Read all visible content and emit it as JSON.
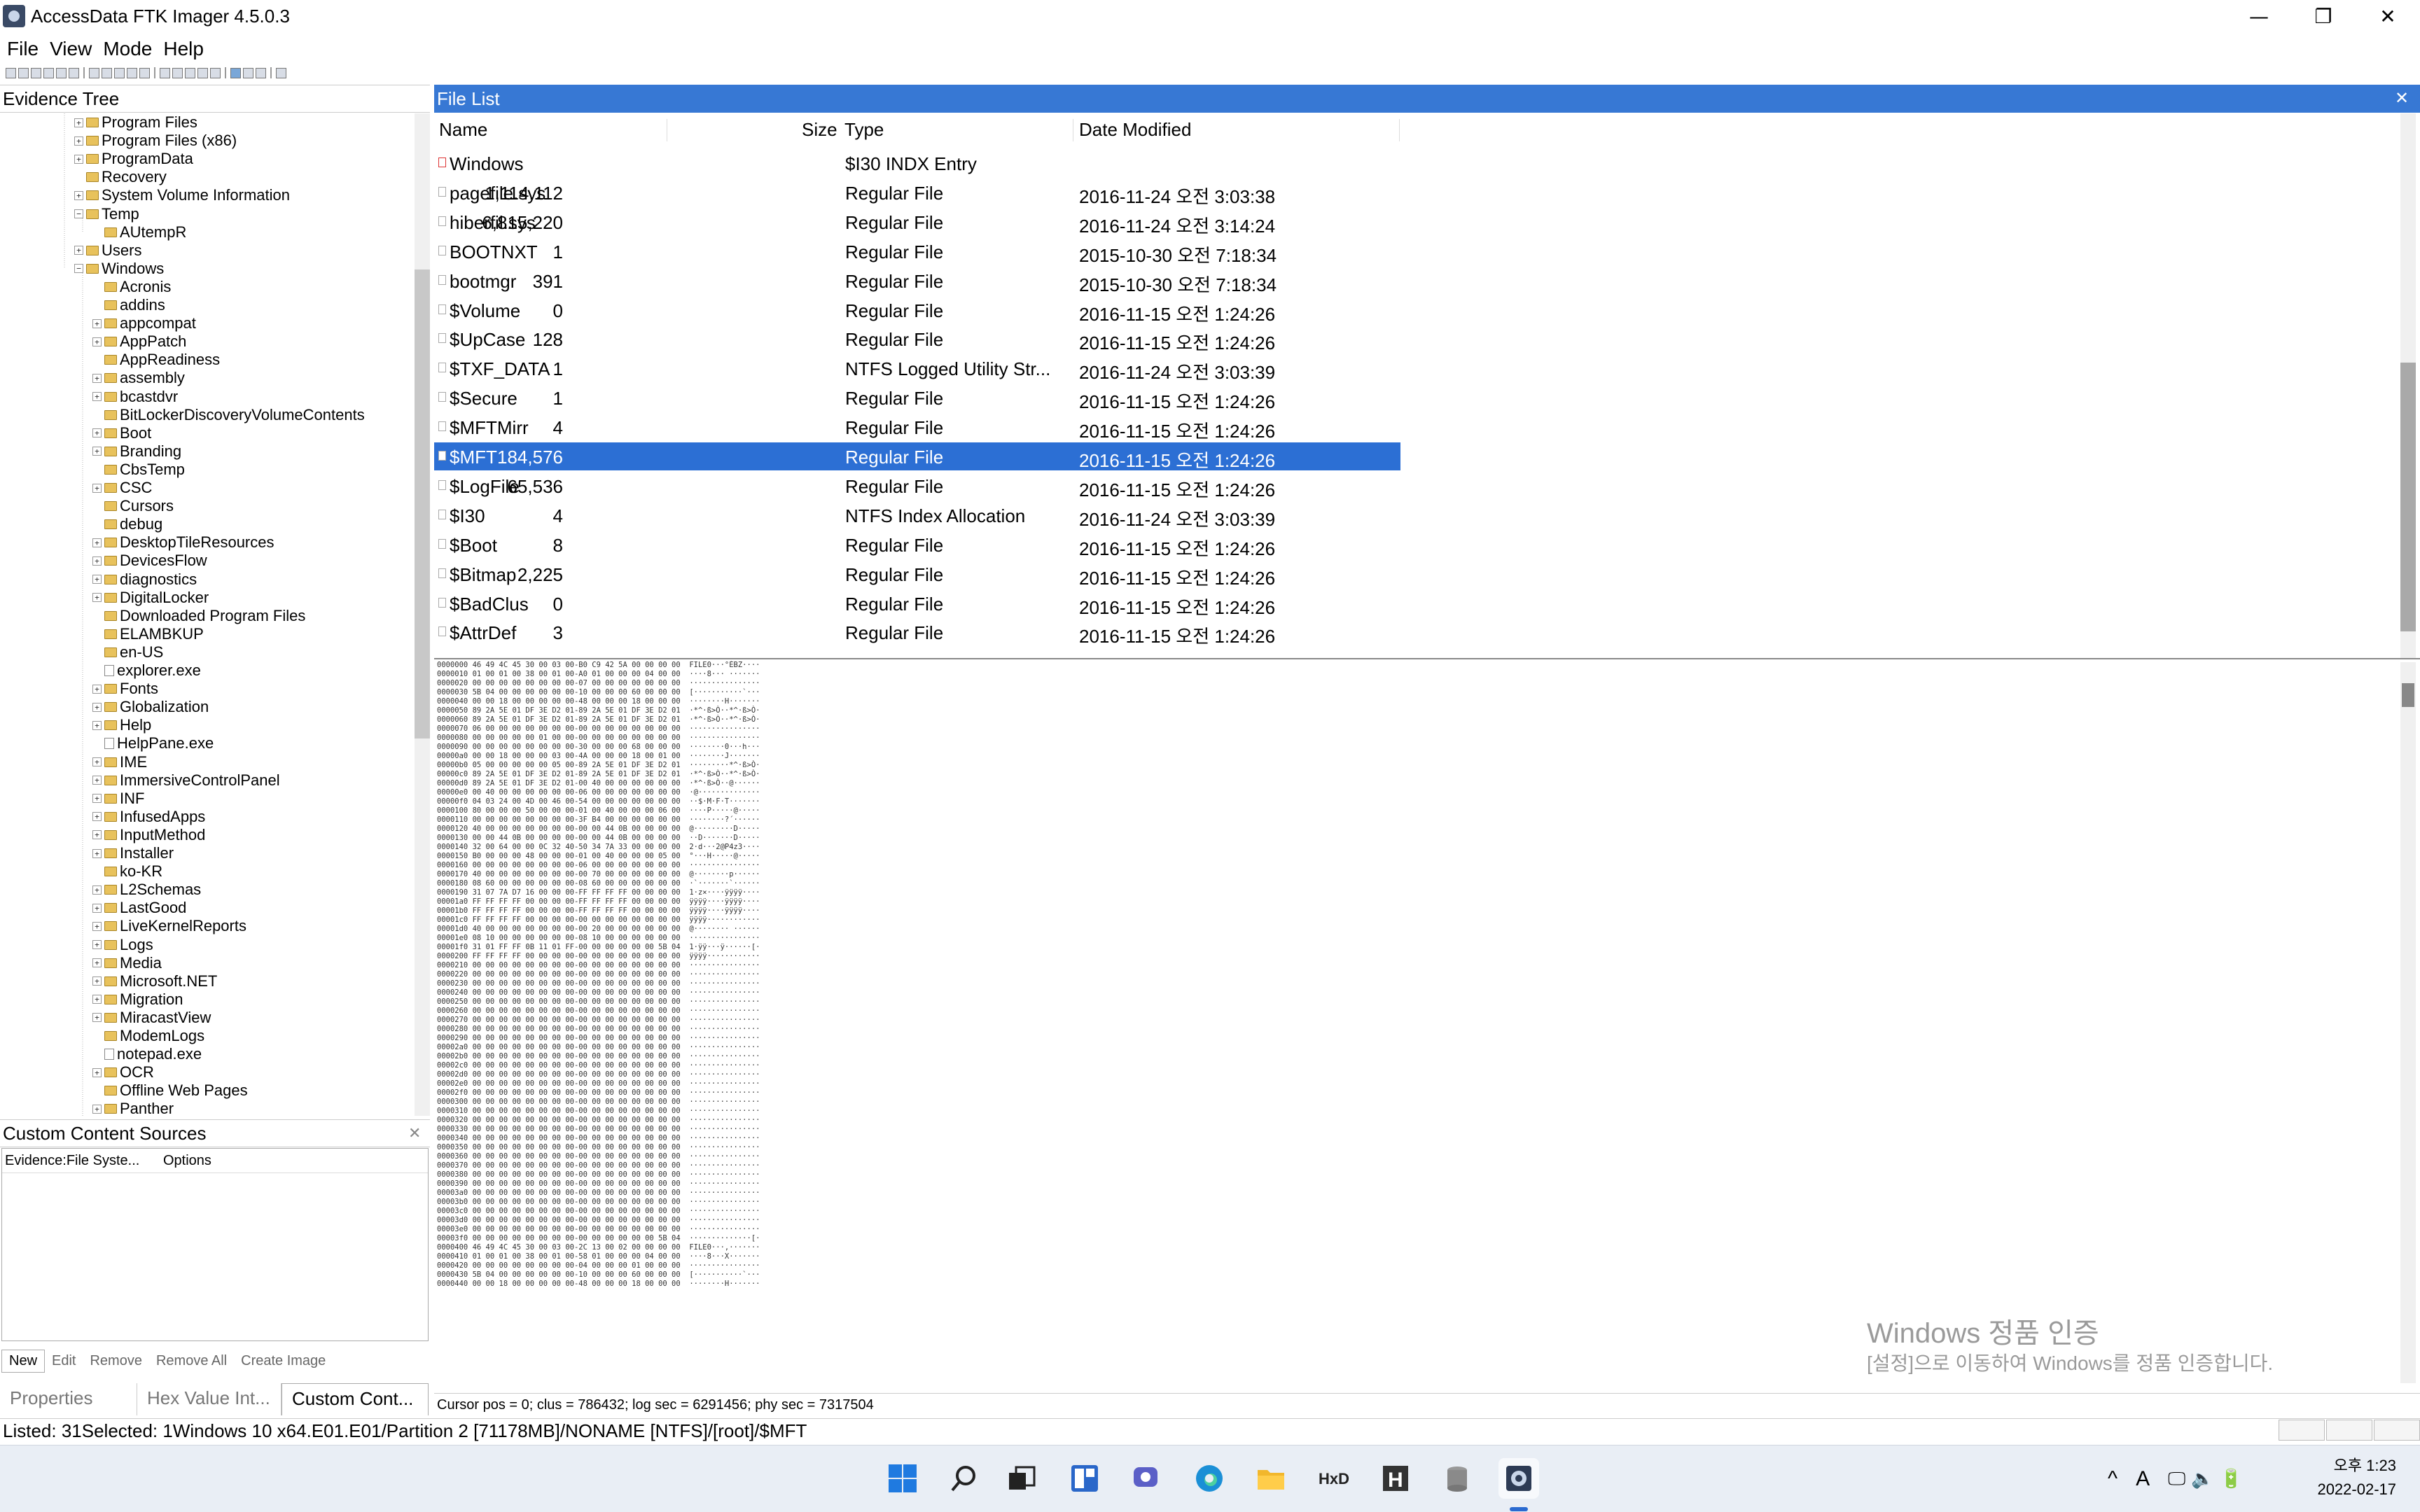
{
  "window": {
    "title": "AccessData FTK Imager 4.5.0.3",
    "controls": {
      "minimize": "—",
      "maximize": "❐",
      "close": "✕"
    }
  },
  "menu": [
    "File",
    "View",
    "Mode",
    "Help"
  ],
  "evidence_tree": {
    "title": "Evidence Tree",
    "items": [
      {
        "label": "Program Files",
        "level": 1,
        "expander": "+"
      },
      {
        "label": "Program Files (x86)",
        "level": 1,
        "expander": "+"
      },
      {
        "label": "ProgramData",
        "level": 1,
        "expander": "+"
      },
      {
        "label": "Recovery",
        "level": 1,
        "expander": ""
      },
      {
        "label": "System Volume Information",
        "level": 1,
        "expander": "+"
      },
      {
        "label": "Temp",
        "level": 1,
        "expander": "−"
      },
      {
        "label": "AUtempR",
        "level": 2,
        "expander": ""
      },
      {
        "label": "Users",
        "level": 1,
        "expander": "+"
      },
      {
        "label": "Windows",
        "level": 1,
        "expander": "−"
      },
      {
        "label": "Acronis",
        "level": 2,
        "expander": ""
      },
      {
        "label": "addins",
        "level": 2,
        "expander": ""
      },
      {
        "label": "appcompat",
        "level": 2,
        "expander": "+"
      },
      {
        "label": "AppPatch",
        "level": 2,
        "expander": "+"
      },
      {
        "label": "AppReadiness",
        "level": 2,
        "expander": ""
      },
      {
        "label": "assembly",
        "level": 2,
        "expander": "+"
      },
      {
        "label": "bcastdvr",
        "level": 2,
        "expander": "+"
      },
      {
        "label": "BitLockerDiscoveryVolumeContents",
        "level": 2,
        "expander": ""
      },
      {
        "label": "Boot",
        "level": 2,
        "expander": "+"
      },
      {
        "label": "Branding",
        "level": 2,
        "expander": "+"
      },
      {
        "label": "CbsTemp",
        "level": 2,
        "expander": ""
      },
      {
        "label": "CSC",
        "level": 2,
        "expander": "+"
      },
      {
        "label": "Cursors",
        "level": 2,
        "expander": ""
      },
      {
        "label": "debug",
        "level": 2,
        "expander": ""
      },
      {
        "label": "DesktopTileResources",
        "level": 2,
        "expander": "+"
      },
      {
        "label": "DevicesFlow",
        "level": 2,
        "expander": "+"
      },
      {
        "label": "diagnostics",
        "level": 2,
        "expander": "+"
      },
      {
        "label": "DigitalLocker",
        "level": 2,
        "expander": "+"
      },
      {
        "label": "Downloaded Program Files",
        "level": 2,
        "expander": ""
      },
      {
        "label": "ELAMBKUP",
        "level": 2,
        "expander": ""
      },
      {
        "label": "en-US",
        "level": 2,
        "expander": ""
      },
      {
        "label": "explorer.exe",
        "level": 2,
        "expander": "",
        "file": true
      },
      {
        "label": "Fonts",
        "level": 2,
        "expander": "+"
      },
      {
        "label": "Globalization",
        "level": 2,
        "expander": "+"
      },
      {
        "label": "Help",
        "level": 2,
        "expander": "+"
      },
      {
        "label": "HelpPane.exe",
        "level": 2,
        "expander": "",
        "file": true
      },
      {
        "label": "IME",
        "level": 2,
        "expander": "+"
      },
      {
        "label": "ImmersiveControlPanel",
        "level": 2,
        "expander": "+"
      },
      {
        "label": "INF",
        "level": 2,
        "expander": "+"
      },
      {
        "label": "InfusedApps",
        "level": 2,
        "expander": "+"
      },
      {
        "label": "InputMethod",
        "level": 2,
        "expander": "+"
      },
      {
        "label": "Installer",
        "level": 2,
        "expander": "+"
      },
      {
        "label": "ko-KR",
        "level": 2,
        "expander": ""
      },
      {
        "label": "L2Schemas",
        "level": 2,
        "expander": "+"
      },
      {
        "label": "LastGood",
        "level": 2,
        "expander": "+"
      },
      {
        "label": "LiveKernelReports",
        "level": 2,
        "expander": "+"
      },
      {
        "label": "Logs",
        "level": 2,
        "expander": "+"
      },
      {
        "label": "Media",
        "level": 2,
        "expander": "+"
      },
      {
        "label": "Microsoft.NET",
        "level": 2,
        "expander": "+"
      },
      {
        "label": "Migration",
        "level": 2,
        "expander": "+"
      },
      {
        "label": "MiracastView",
        "level": 2,
        "expander": "+"
      },
      {
        "label": "ModemLogs",
        "level": 2,
        "expander": ""
      },
      {
        "label": "notepad.exe",
        "level": 2,
        "expander": "",
        "file": true
      },
      {
        "label": "OCR",
        "level": 2,
        "expander": "+"
      },
      {
        "label": "Offline Web Pages",
        "level": 2,
        "expander": ""
      },
      {
        "label": "Panther",
        "level": 2,
        "expander": "+"
      }
    ]
  },
  "custom_content": {
    "title": "Custom Content Sources",
    "close": "✕",
    "columns": [
      "Evidence:File Syste...",
      "Options"
    ],
    "buttons": [
      "New",
      "Edit",
      "Remove",
      "Remove All",
      "Create Image"
    ]
  },
  "bottom_tabs": [
    "Properties",
    "Hex Value Int...",
    "Custom Cont..."
  ],
  "file_list": {
    "title": "File List",
    "close": "✕",
    "columns": [
      "Name",
      "Size",
      "Type",
      "Date Modified"
    ],
    "selected_index": 9,
    "rows": [
      {
        "name": "Windows",
        "size": "",
        "type": "$I30 INDX Entry",
        "date": "",
        "deleted": true
      },
      {
        "name": "pagefile.sys",
        "size": "1,114,112",
        "type": "Regular File",
        "date": "2016-11-24 오전 3:03:38"
      },
      {
        "name": "hiberfil.sys",
        "size": "6,815,220",
        "type": "Regular File",
        "date": "2016-11-24 오전 3:14:24"
      },
      {
        "name": "BOOTNXT",
        "size": "1",
        "type": "Regular File",
        "date": "2015-10-30 오전 7:18:34"
      },
      {
        "name": "bootmgr",
        "size": "391",
        "type": "Regular File",
        "date": "2015-10-30 오전 7:18:34"
      },
      {
        "name": "$Volume",
        "size": "0",
        "type": "Regular File",
        "date": "2016-11-15 오전 1:24:26"
      },
      {
        "name": "$UpCase",
        "size": "128",
        "type": "Regular File",
        "date": "2016-11-15 오전 1:24:26"
      },
      {
        "name": "$TXF_DATA",
        "size": "1",
        "type": "NTFS Logged Utility Str...",
        "date": "2016-11-24 오전 3:03:39"
      },
      {
        "name": "$Secure",
        "size": "1",
        "type": "Regular File",
        "date": "2016-11-15 오전 1:24:26"
      },
      {
        "name": "$MFTMirr",
        "size": "4",
        "type": "Regular File",
        "date": "2016-11-15 오전 1:24:26"
      },
      {
        "name": "$MFT",
        "size": "184,576",
        "type": "Regular File",
        "date": "2016-11-15 오전 1:24:26"
      },
      {
        "name": "$LogFile",
        "size": "65,536",
        "type": "Regular File",
        "date": "2016-11-15 오전 1:24:26"
      },
      {
        "name": "$I30",
        "size": "4",
        "type": "NTFS Index Allocation",
        "date": "2016-11-24 오전 3:03:39"
      },
      {
        "name": "$Boot",
        "size": "8",
        "type": "Regular File",
        "date": "2016-11-15 오전 1:24:26"
      },
      {
        "name": "$Bitmap",
        "size": "2,225",
        "type": "Regular File",
        "date": "2016-11-15 오전 1:24:26"
      },
      {
        "name": "$BadClus",
        "size": "0",
        "type": "Regular File",
        "date": "2016-11-15 오전 1:24:26"
      },
      {
        "name": "$AttrDef",
        "size": "3",
        "type": "Regular File",
        "date": "2016-11-15 오전 1:24:26"
      }
    ]
  },
  "hex": {
    "lines": [
      "0000000 46 49 4C 45 30 00 03 00-B0 C9 42 5A 00 00 00 00  FILE0···°ÉBZ····",
      "0000010 01 00 01 00 38 00 01 00-A0 01 00 00 00 04 00 00  ····8··· ·······",
      "0000020 00 00 00 00 00 00 00 00-07 00 00 00 00 00 00 00  ················",
      "0000030 5B 04 00 00 00 00 00 00-10 00 00 00 60 00 00 00  [···········`···",
      "0000040 00 00 18 00 00 00 00 00-48 00 00 00 18 00 00 00  ········H·······",
      "0000050 89 2A 5E 01 DF 3E D2 01-89 2A 5E 01 DF 3E D2 01  ·*^·ß>Ò··*^·ß>Ò·",
      "0000060 89 2A 5E 01 DF 3E D2 01-89 2A 5E 01 DF 3E D2 01  ·*^·ß>Ò··*^·ß>Ò·",
      "0000070 06 00 00 00 00 00 00 00-00 00 00 00 00 00 00 00  ················",
      "0000080 00 00 00 00 00 01 00 00-00 00 00 00 00 00 00 00  ················",
      "0000090 00 00 00 00 00 00 00 00-30 00 00 00 68 00 00 00  ········0···h···",
      "00000a0 00 00 18 00 00 00 03 00-4A 00 00 00 18 00 01 00  ········J·······",
      "00000b0 05 00 00 00 00 00 05 00-89 2A 5E 01 DF 3E D2 01  ·········*^·ß>Ò·",
      "00000c0 89 2A 5E 01 DF 3E D2 01-89 2A 5E 01 DF 3E D2 01  ·*^·ß>Ò··*^·ß>Ò·",
      "00000d0 89 2A 5E 01 DF 3E D2 01-00 40 00 00 00 00 00 00  ·*^·ß>Ò··@······",
      "00000e0 00 40 00 00 00 00 00 00-06 00 00 00 00 00 00 00  ·@··············",
      "00000f0 04 03 24 00 4D 00 46 00-54 00 00 00 00 00 00 00  ··$·M·F·T·······",
      "0000100 80 00 00 00 50 00 00 00-01 00 40 00 00 00 06 00  ····P·····@·····",
      "0000110 00 00 00 00 00 00 00 00-3F B4 00 00 00 00 00 00  ········?´······",
      "0000120 40 00 00 00 00 00 00 00-00 00 44 0B 00 00 00 00  @·········D·····",
      "0000130 00 00 44 0B 00 00 00 00-00 00 44 0B 00 00 00 00  ··D·······D·····",
      "0000140 32 00 64 00 00 0C 32 40-50 34 7A 33 00 00 00 00  2·d···2@P4z3····",
      "0000150 B0 00 00 00 48 00 00 00-01 00 40 00 00 00 05 00  °···H·····@·····",
      "0000160 00 00 00 00 00 00 00 00-06 00 00 00 00 00 00 00  ················",
      "0000170 40 00 00 00 00 00 00 00-00 70 00 00 00 00 00 00  @········p······",
      "0000180 08 60 00 00 00 00 00 00-08 60 00 00 00 00 00 00  ·`·······`······",
      "0000190 31 07 7A D7 16 00 00 00-FF FF FF FF 00 00 00 00  1·z×····ÿÿÿÿ····",
      "00001a0 FF FF FF FF 00 00 00 00-FF FF FF FF 00 00 00 00  ÿÿÿÿ····ÿÿÿÿ····",
      "00001b0 FF FF FF FF 00 00 00 00-FF FF FF FF 00 00 00 00  ÿÿÿÿ····ÿÿÿÿ····",
      "00001c0 FF FF FF FF 00 00 00 00-00 00 00 00 00 00 00 00  ÿÿÿÿ············",
      "00001d0 40 00 00 00 00 00 00 00-00 20 00 00 00 00 00 00  @········ ······",
      "00001e0 08 10 00 00 00 00 00 00-08 10 00 00 00 00 00 00  ················",
      "00001f0 31 01 FF FF 0B 11 01 FF-00 00 00 00 00 00 5B 04  1·ÿÿ···ÿ······[·",
      "0000200 FF FF FF FF 00 00 00 00-00 00 00 00 00 00 00 00  ÿÿÿÿ············",
      "0000210 00 00 00 00 00 00 00 00-00 00 00 00 00 00 00 00  ················",
      "0000220 00 00 00 00 00 00 00 00-00 00 00 00 00 00 00 00  ················",
      "0000230 00 00 00 00 00 00 00 00-00 00 00 00 00 00 00 00  ················",
      "0000240 00 00 00 00 00 00 00 00-00 00 00 00 00 00 00 00  ················",
      "0000250 00 00 00 00 00 00 00 00-00 00 00 00 00 00 00 00  ················",
      "0000260 00 00 00 00 00 00 00 00-00 00 00 00 00 00 00 00  ················",
      "0000270 00 00 00 00 00 00 00 00-00 00 00 00 00 00 00 00  ················",
      "0000280 00 00 00 00 00 00 00 00-00 00 00 00 00 00 00 00  ················",
      "0000290 00 00 00 00 00 00 00 00-00 00 00 00 00 00 00 00  ················",
      "00002a0 00 00 00 00 00 00 00 00-00 00 00 00 00 00 00 00  ················",
      "00002b0 00 00 00 00 00 00 00 00-00 00 00 00 00 00 00 00  ················",
      "00002c0 00 00 00 00 00 00 00 00-00 00 00 00 00 00 00 00  ················",
      "00002d0 00 00 00 00 00 00 00 00-00 00 00 00 00 00 00 00  ················",
      "00002e0 00 00 00 00 00 00 00 00-00 00 00 00 00 00 00 00  ················",
      "00002f0 00 00 00 00 00 00 00 00-00 00 00 00 00 00 00 00  ················",
      "0000300 00 00 00 00 00 00 00 00-00 00 00 00 00 00 00 00  ················",
      "0000310 00 00 00 00 00 00 00 00-00 00 00 00 00 00 00 00  ················",
      "0000320 00 00 00 00 00 00 00 00-00 00 00 00 00 00 00 00  ················",
      "0000330 00 00 00 00 00 00 00 00-00 00 00 00 00 00 00 00  ················",
      "0000340 00 00 00 00 00 00 00 00-00 00 00 00 00 00 00 00  ················",
      "0000350 00 00 00 00 00 00 00 00-00 00 00 00 00 00 00 00  ················",
      "0000360 00 00 00 00 00 00 00 00-00 00 00 00 00 00 00 00  ················",
      "0000370 00 00 00 00 00 00 00 00-00 00 00 00 00 00 00 00  ················",
      "0000380 00 00 00 00 00 00 00 00-00 00 00 00 00 00 00 00  ················",
      "0000390 00 00 00 00 00 00 00 00-00 00 00 00 00 00 00 00  ················",
      "00003a0 00 00 00 00 00 00 00 00-00 00 00 00 00 00 00 00  ················",
      "00003b0 00 00 00 00 00 00 00 00-00 00 00 00 00 00 00 00  ················",
      "00003c0 00 00 00 00 00 00 00 00-00 00 00 00 00 00 00 00  ················",
      "00003d0 00 00 00 00 00 00 00 00-00 00 00 00 00 00 00 00  ················",
      "00003e0 00 00 00 00 00 00 00 00-00 00 00 00 00 00 00 00  ················",
      "00003f0 00 00 00 00 00 00 00 00-00 00 00 00 00 00 5B 04  ··············[·",
      "0000400 46 49 4C 45 30 00 03 00-2C 13 00 02 00 00 00 00  FILE0···,·······",
      "0000410 01 00 01 00 38 00 01 00-58 01 00 00 00 04 00 00  ····8···X·······",
      "0000420 00 00 00 00 00 00 00 00-04 00 00 00 01 00 00 00  ················",
      "0000430 5B 04 00 00 00 00 00 00-10 00 00 00 60 00 00 00  [···········`···",
      "0000440 00 00 18 00 00 00 00 00-48 00 00 00 18 00 00 00  ········H·······"
    ]
  },
  "watermark": {
    "line1": "Windows 정품 인증",
    "line2": "[설정]으로 이동하여 Windows를 정품 인증합니다."
  },
  "cursor_info": "Cursor pos = 0; clus = 786432; log sec = 6291456; phy sec = 7317504",
  "status": "Listed: 31Selected: 1Windows 10 x64.E01.E01/Partition 2 [71178MB]/NONAME [NTFS]/[root]/$MFT",
  "taskbar": {
    "apps": [
      "windows-start-icon",
      "search-icon",
      "task-view-icon",
      "widgets-icon",
      "chat-icon",
      "edge-icon",
      "file-explorer-icon",
      "hex-editor-icon",
      "hxd-icon",
      "database-icon",
      "ftk-imager-icon"
    ],
    "tray": {
      "chevron": "^",
      "ime": "A",
      "icons": "🖵  🔈  🔋"
    },
    "time": "오후 1:23",
    "date": "2022-02-17"
  },
  "colors": {
    "accent": "#3778d4",
    "selection": "#2c6fd4",
    "folder": "#e8c25c"
  }
}
